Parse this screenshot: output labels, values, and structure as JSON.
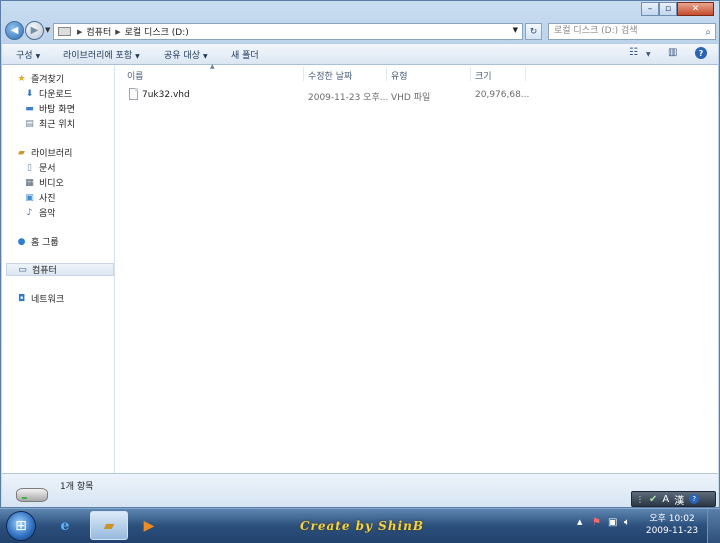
{
  "window": {
    "controls": {
      "minimize": "–",
      "maximize": "▫",
      "close": "✕"
    }
  },
  "address": {
    "segments": [
      "컴퓨터",
      "로컬 디스크 (D:)"
    ],
    "search_placeholder": "로컬 디스크 (D:) 검색"
  },
  "toolbar": {
    "organize": "구성",
    "include_in_library": "라이브러리에 포함",
    "share_with": "공유 대상",
    "new_folder": "새 폴더"
  },
  "nav": {
    "favorites": "즐겨찾기",
    "downloads": "다운로드",
    "desktop": "바탕 화면",
    "recent_places": "최근 위치",
    "libraries": "라이브러리",
    "documents": "문서",
    "videos": "비디오",
    "pictures": "사진",
    "music": "음악",
    "homegroup": "홈 그룹",
    "computer": "컴퓨터",
    "network": "네트워크"
  },
  "columns": {
    "name": "이름",
    "date_modified": "수정한 날짜",
    "type": "유형",
    "size": "크기"
  },
  "files": [
    {
      "name": "7uk32.vhd",
      "date": "2009-11-23 오후...",
      "type": "VHD 파일",
      "size": "20,976,68..."
    }
  ],
  "details": {
    "item_count": "1개 항목"
  },
  "taskbar": {
    "brand_text": "Create by ShinB",
    "time": "오후 10:02",
    "date": "2009-11-23"
  },
  "language_bar": {
    "ime_mode": "A",
    "hanja": "漢"
  },
  "icons": {
    "back": "back-arrow-icon",
    "forward": "forward-arrow-icon",
    "refresh": "refresh-icon",
    "search": "search-icon",
    "help": "help-icon",
    "view": "view-options-icon",
    "preview": "preview-pane-icon",
    "drive": "hard-drive-icon",
    "start": "windows-orb-icon"
  }
}
